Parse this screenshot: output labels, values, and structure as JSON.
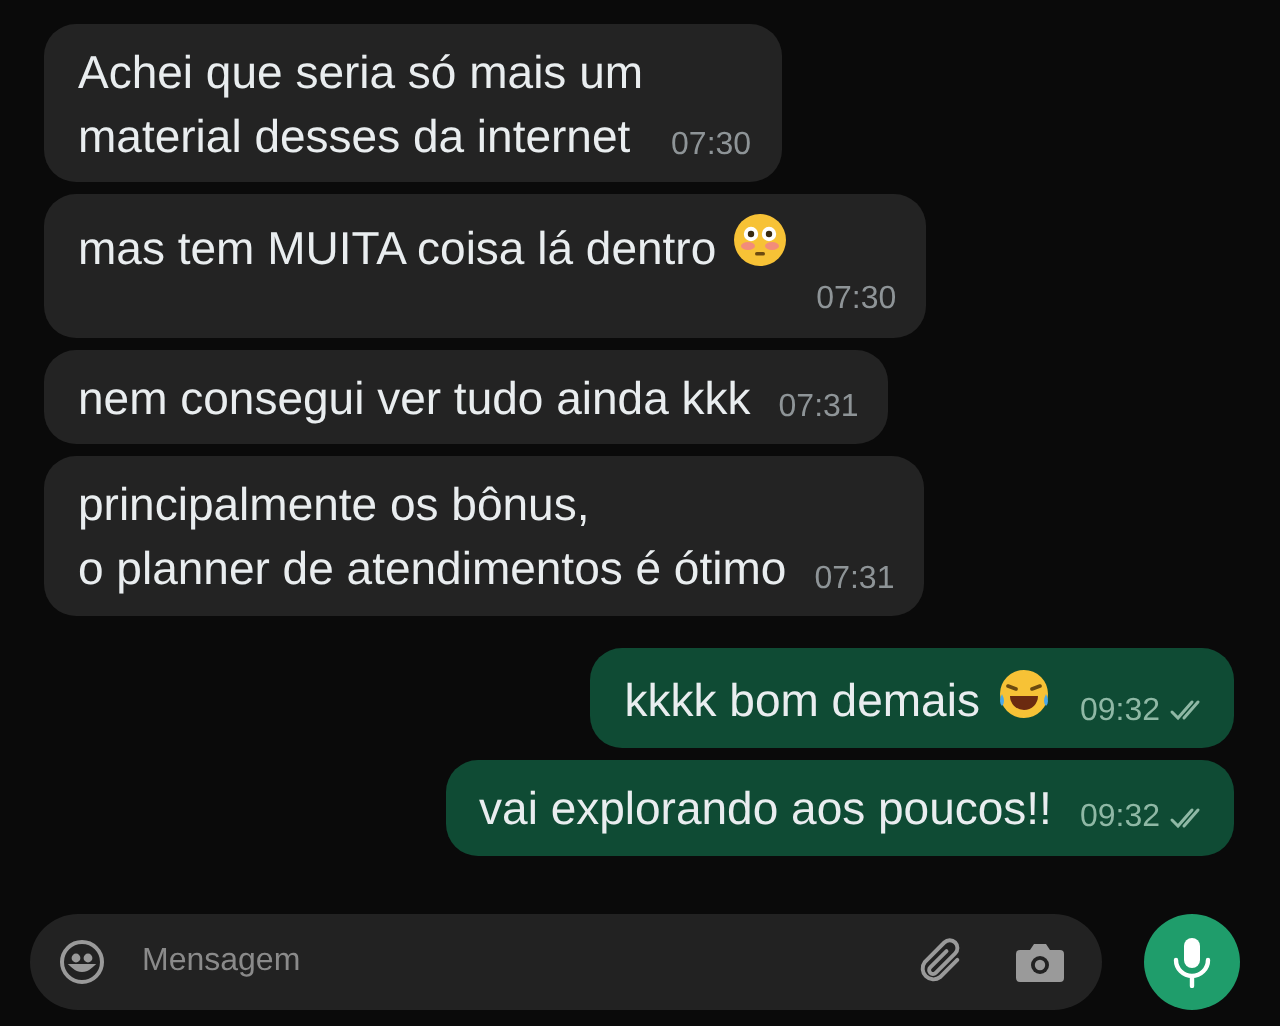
{
  "messages": [
    {
      "kind": "incoming",
      "lines": [
        "Achei que seria só mais um",
        "material desses da internet"
      ],
      "time": "07:30"
    },
    {
      "kind": "incoming",
      "lines": [
        "mas tem MUITA coisa lá dentro"
      ],
      "emoji": {
        "kind": "flushed"
      },
      "time": "07:30"
    },
    {
      "kind": "incoming",
      "lines": [
        "nem consegui ver tudo ainda kkk"
      ],
      "time": "07:31"
    },
    {
      "kind": "incoming",
      "lines": [
        "principalmente os bônus,",
        "o planner de atendimentos é ótimo"
      ],
      "time": "07:31"
    },
    {
      "kind": "outgoing",
      "lines": [
        "kkkk bom demais"
      ],
      "emoji": {
        "kind": "laughing"
      },
      "time": "09:32",
      "read": false
    },
    {
      "kind": "outgoing",
      "lines": [
        "vai explorando aos poucos!!"
      ],
      "time": "09:32",
      "read": false
    }
  ],
  "composer": {
    "placeholder": "Mensagem"
  }
}
